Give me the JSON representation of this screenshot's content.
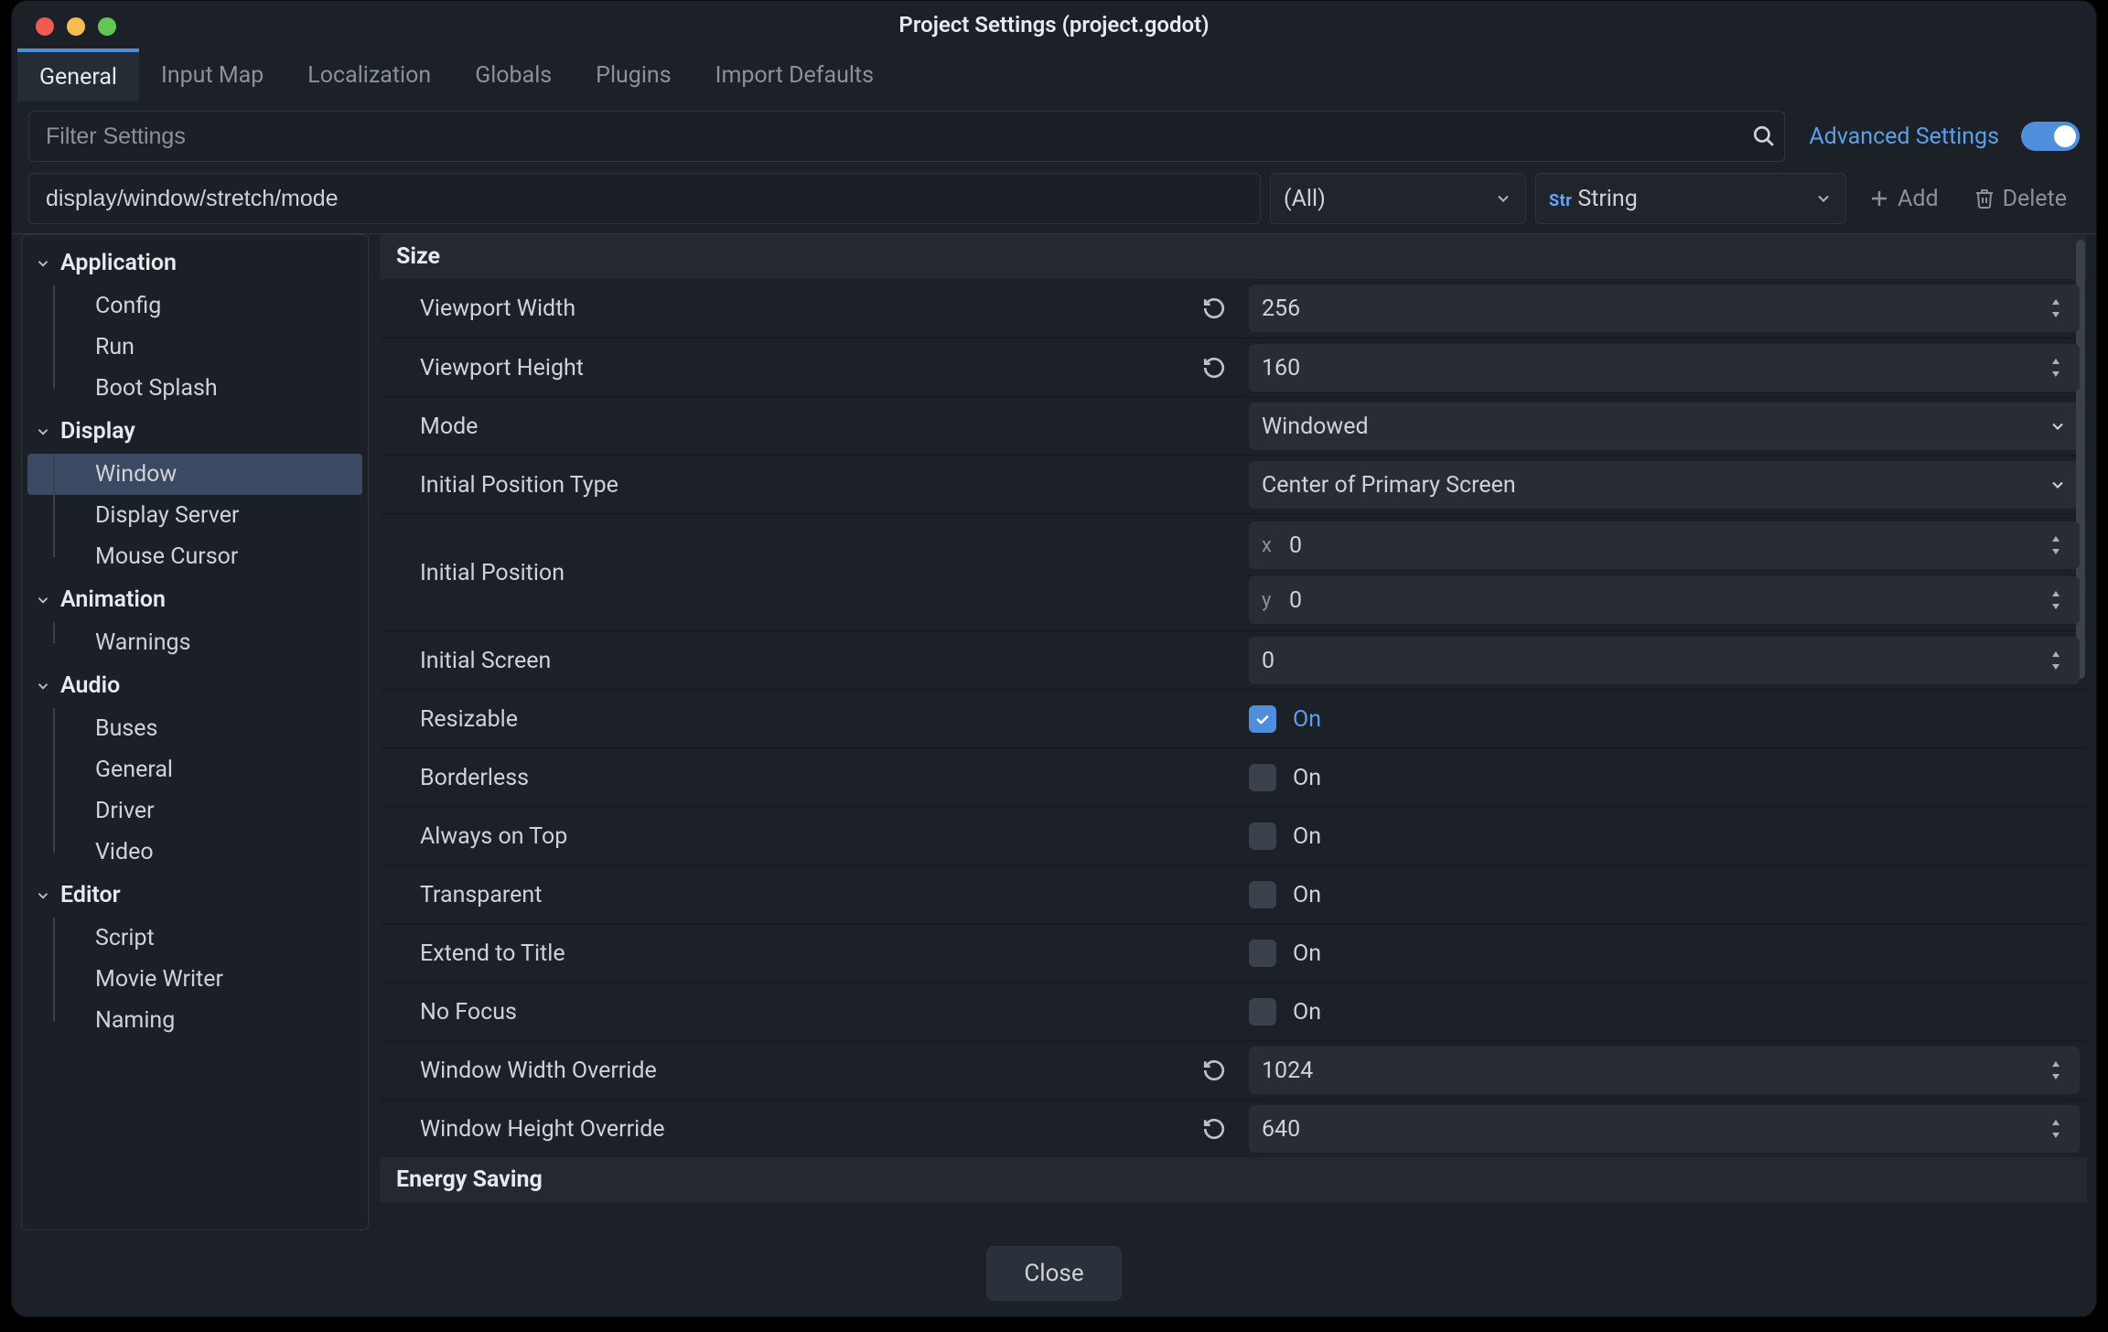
{
  "window_title": "Project Settings (project.godot)",
  "tabs": [
    "General",
    "Input Map",
    "Localization",
    "Globals",
    "Plugins",
    "Import Defaults"
  ],
  "active_tab": "General",
  "filter_placeholder": "Filter Settings",
  "advanced_label": "Advanced Settings",
  "path_value": "display/window/stretch/mode",
  "feature_dd": "(All)",
  "type_dd": "String",
  "type_tag": "Str",
  "add_label": "Add",
  "delete_label": "Delete",
  "sidebar": [
    {
      "cat": "Application",
      "items": [
        "Config",
        "Run",
        "Boot Splash"
      ]
    },
    {
      "cat": "Display",
      "items": [
        "Window",
        "Display Server",
        "Mouse Cursor"
      ],
      "selected": "Window"
    },
    {
      "cat": "Animation",
      "items": [
        "Warnings"
      ]
    },
    {
      "cat": "Audio",
      "items": [
        "Buses",
        "General",
        "Driver",
        "Video"
      ]
    },
    {
      "cat": "Editor",
      "items": [
        "Script",
        "Movie Writer",
        "Naming"
      ]
    }
  ],
  "sections": {
    "size_title": "Size",
    "energy_title": "Energy Saving"
  },
  "props": {
    "viewport_width": {
      "label": "Viewport Width",
      "value": "256",
      "revert": true,
      "kind": "spin"
    },
    "viewport_height": {
      "label": "Viewport Height",
      "value": "160",
      "revert": true,
      "kind": "spin"
    },
    "mode": {
      "label": "Mode",
      "value": "Windowed",
      "kind": "select"
    },
    "initial_pos_type": {
      "label": "Initial Position Type",
      "value": "Center of Primary Screen",
      "kind": "select"
    },
    "initial_pos": {
      "label": "Initial Position",
      "x": "0",
      "y": "0",
      "kind": "vec2"
    },
    "initial_screen": {
      "label": "Initial Screen",
      "value": "0",
      "kind": "spin"
    },
    "resizable": {
      "label": "Resizable",
      "value": "On",
      "on": true,
      "kind": "check"
    },
    "borderless": {
      "label": "Borderless",
      "value": "On",
      "on": false,
      "kind": "check"
    },
    "always_on_top": {
      "label": "Always on Top",
      "value": "On",
      "on": false,
      "kind": "check"
    },
    "transparent": {
      "label": "Transparent",
      "value": "On",
      "on": false,
      "kind": "check"
    },
    "extend_to_title": {
      "label": "Extend to Title",
      "value": "On",
      "on": false,
      "kind": "check"
    },
    "no_focus": {
      "label": "No Focus",
      "value": "On",
      "on": false,
      "kind": "check"
    },
    "win_w_override": {
      "label": "Window Width Override",
      "value": "1024",
      "revert": true,
      "kind": "spin"
    },
    "win_h_override": {
      "label": "Window Height Override",
      "value": "640",
      "revert": true,
      "kind": "spin"
    }
  },
  "close_label": "Close"
}
